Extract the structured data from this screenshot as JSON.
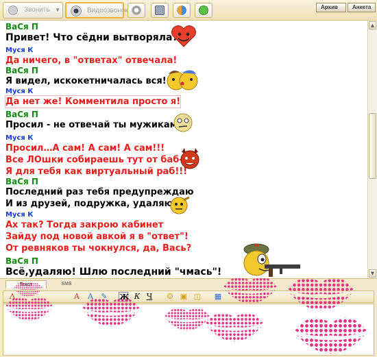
{
  "toolbar": {
    "voice_call": "Звонить",
    "video_call": "Видеозвонок",
    "archive": "Архив",
    "profile": "Анкета"
  },
  "messages": [
    {
      "sender": "ВаСя П",
      "lines": [
        "Привет! Что сёдни вытворяла?"
      ]
    },
    {
      "sender": "Муся К",
      "lines": [
        "Да ничего, в \"ответах\" отвечала!"
      ]
    },
    {
      "sender": "ВаСя П",
      "lines": [
        "Я видел, искокетничалась вся!"
      ]
    },
    {
      "sender": "Муся К",
      "lines": [
        "Да нет же! Комментила просто я!"
      ]
    },
    {
      "sender": "ВаСя П",
      "lines": [
        "Просил - не отвечай ты мужикам!"
      ]
    },
    {
      "sender": "Муся К",
      "lines": [
        "Просил…А сам! А сам! А сам!!!",
        "Все ЛОшки собираешь тут от баб-",
        "Я для тебя как виртуальный раб!!!"
      ]
    },
    {
      "sender": "ВаСя П",
      "lines": [
        "Последний раз тебя предупреждаю",
        "И из друзей, подружка, удаляю!"
      ]
    },
    {
      "sender": "Муся К",
      "lines": [
        "Ах так? Тогда закрою кабинет",
        "Зайду под новой авкой я в \"ответ\"!",
        "От ревняков ты чокнулся, да, Вась?"
      ]
    },
    {
      "sender": "ВаСя П",
      "lines": [
        "Всё,удаляю! Шлю последний \"чмась\"!"
      ]
    }
  ],
  "composer": {
    "tab_text": "Текст",
    "tab_sms": "SMS",
    "bold": "Ж",
    "italic": "К",
    "underline": "Ч"
  },
  "colors": {
    "vasya_nick": "#138a13",
    "musya_nick": "#1c3ad1",
    "musya_text": "#e51e1e",
    "kiss": "#e0287f"
  },
  "icons": [
    "phone-icon",
    "webcam-icon",
    "smiley-heart-icon",
    "kissing-pair-icon",
    "pensive-smiley-icon",
    "devil-smiley-icon",
    "salute-smiley-icon",
    "soldier-gun-smiley-icon",
    "lipstick-kiss-icon"
  ]
}
